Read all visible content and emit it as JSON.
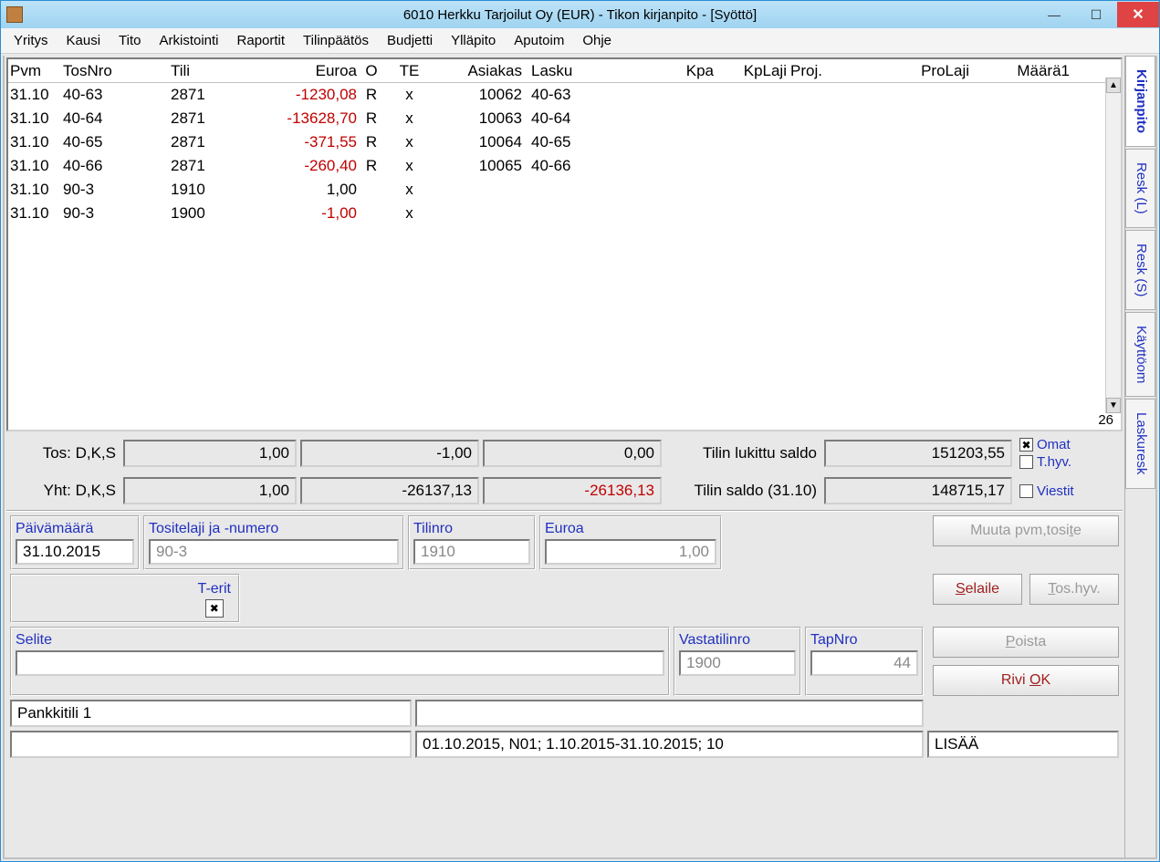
{
  "window": {
    "title": "6010  Herkku Tarjoilut Oy (EUR) - Tikon kirjanpito - [Syöttö]"
  },
  "menu": [
    "Yritys",
    "Kausi",
    "Tito",
    "Arkistointi",
    "Raportit",
    "Tilinpäätös",
    "Budjetti",
    "Ylläpito",
    "Aputoim",
    "Ohje"
  ],
  "grid": {
    "headers": {
      "pvm": "Pvm",
      "tosnro": "TosNro",
      "tili": "Tili",
      "euroa": "Euroa",
      "o": "O",
      "te": "TE",
      "asiakas": "Asiakas",
      "lasku": "Lasku",
      "kpa": "Kpa",
      "kplaji": "KpLaji",
      "proj": "Proj.",
      "prolaji": "ProLaji",
      "maara1": "Määrä1"
    },
    "rows": [
      {
        "pvm": "31.10",
        "tos": "40-63",
        "tili": "2871",
        "eur": "-1230,08",
        "neg": true,
        "o": "R",
        "te": "x",
        "asiakas": "10062",
        "lasku": "40-63"
      },
      {
        "pvm": "31.10",
        "tos": "40-64",
        "tili": "2871",
        "eur": "-13628,70",
        "neg": true,
        "o": "R",
        "te": "x",
        "asiakas": "10063",
        "lasku": "40-64"
      },
      {
        "pvm": "31.10",
        "tos": "40-65",
        "tili": "2871",
        "eur": "-371,55",
        "neg": true,
        "o": "R",
        "te": "x",
        "asiakas": "10064",
        "lasku": "40-65"
      },
      {
        "pvm": "31.10",
        "tos": "40-66",
        "tili": "2871",
        "eur": "-260,40",
        "neg": true,
        "o": "R",
        "te": "x",
        "asiakas": "10065",
        "lasku": "40-66"
      },
      {
        "pvm": "31.10",
        "tos": "90-3",
        "tili": "1910",
        "eur": "1,00",
        "neg": false,
        "o": "",
        "te": "x",
        "asiakas": "",
        "lasku": ""
      },
      {
        "pvm": "31.10",
        "tos": "90-3",
        "tili": "1900",
        "eur": "-1,00",
        "neg": true,
        "o": "",
        "te": "x",
        "asiakas": "",
        "lasku": ""
      }
    ],
    "row_count": "26"
  },
  "totals": {
    "tos_label": "Tos: D,K,S",
    "tos_d": "1,00",
    "tos_k": "-1,00",
    "tos_s": "0,00",
    "locked_label": "Tilin lukittu saldo",
    "locked": "151203,55",
    "yht_label": "Yht: D,K,S",
    "yht_d": "1,00",
    "yht_k": "-26137,13",
    "yht_s": "-26136,13",
    "saldo_label": "Tilin saldo (31.10)",
    "saldo": "148715,17",
    "chk_omat": "Omat",
    "chk_thyv": "T.hyv.",
    "chk_viestit": "Viestit"
  },
  "entry": {
    "pvm_label": "Päivämäärä",
    "pvm": "31.10.2015",
    "tositelaji_label": "Tositelaji ja -numero",
    "tositelaji": "90-3",
    "tilinro_label": "Tilinro",
    "tilinro": "1910",
    "euroa_label": "Euroa",
    "euroa": "1,00",
    "terit_label": "T-erit",
    "selite_label": "Selite",
    "selite": "",
    "vastatili_label": "Vastatilinro",
    "vastatili": "1900",
    "tapnro_label": "TapNro",
    "tapnro": "44",
    "desc1": "Pankkitili 1",
    "desc2": "",
    "period": "01.10.2015, N01; 1.10.2015-31.10.2015; 10",
    "mode": "LISÄÄ"
  },
  "buttons": {
    "muuta": "Muuta pvm,tosite",
    "selaile": "Selaile",
    "toshyv": "Tos.hyv.",
    "poista": "Poista",
    "riviok": "Rivi OK"
  },
  "side_tabs": [
    "Kirjanpito",
    "Resk (L)",
    "Resk (S)",
    "Käyttöom",
    "Laskuresk"
  ]
}
